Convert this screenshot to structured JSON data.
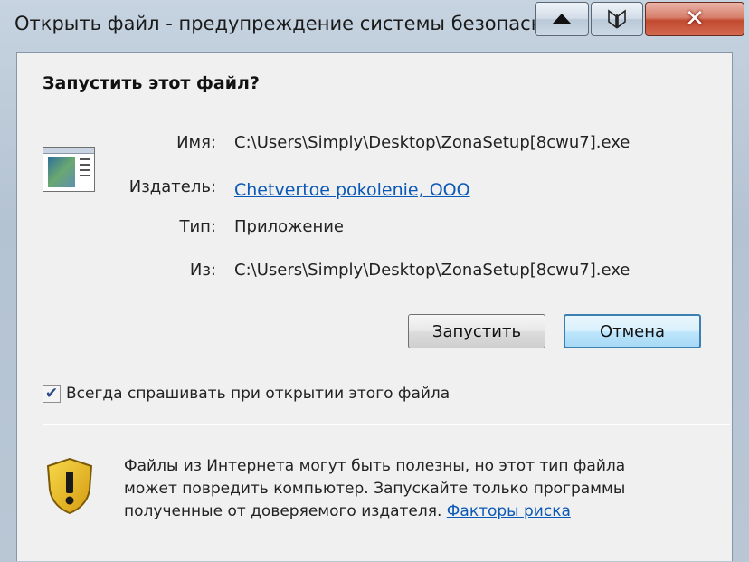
{
  "window": {
    "title": "Открыть файл - предупреждение системы безопасн",
    "min_label": "",
    "close_label": "✕"
  },
  "dialog": {
    "question": "Запустить этот файл?",
    "fields": {
      "name_label": "Имя:",
      "name_value": "C:\\Users\\Simply\\Desktop\\ZonaSetup[8cwu7].exe",
      "publisher_label": "Издатель:",
      "publisher_value": "Chetvertoe pokolenie, OOO",
      "type_label": "Тип:",
      "type_value": "Приложение",
      "from_label": "Из:",
      "from_value": "C:\\Users\\Simply\\Desktop\\ZonaSetup[8cwu7].exe"
    },
    "buttons": {
      "run": "Запустить",
      "cancel": "Отмена"
    },
    "checkbox": {
      "label": "Всегда спрашивать при открытии этого файла",
      "checked": true
    },
    "warning": {
      "line1": "Файлы из Интернета могут быть полезны, но этот тип файла",
      "line2": "может повредить компьютер. Запускайте только программы",
      "line3_prefix": "полученные от доверяемого издателя.",
      "risk_link": "Факторы риска"
    }
  },
  "colors": {
    "link": "#0b59b6",
    "close_button": "#c14a2f",
    "default_button_border": "#3c7fb1"
  },
  "icons": {
    "file": "application-file-icon",
    "shield": "security-shield-icon",
    "restore": "restore-icon",
    "minimize": "triangle-up-icon"
  }
}
